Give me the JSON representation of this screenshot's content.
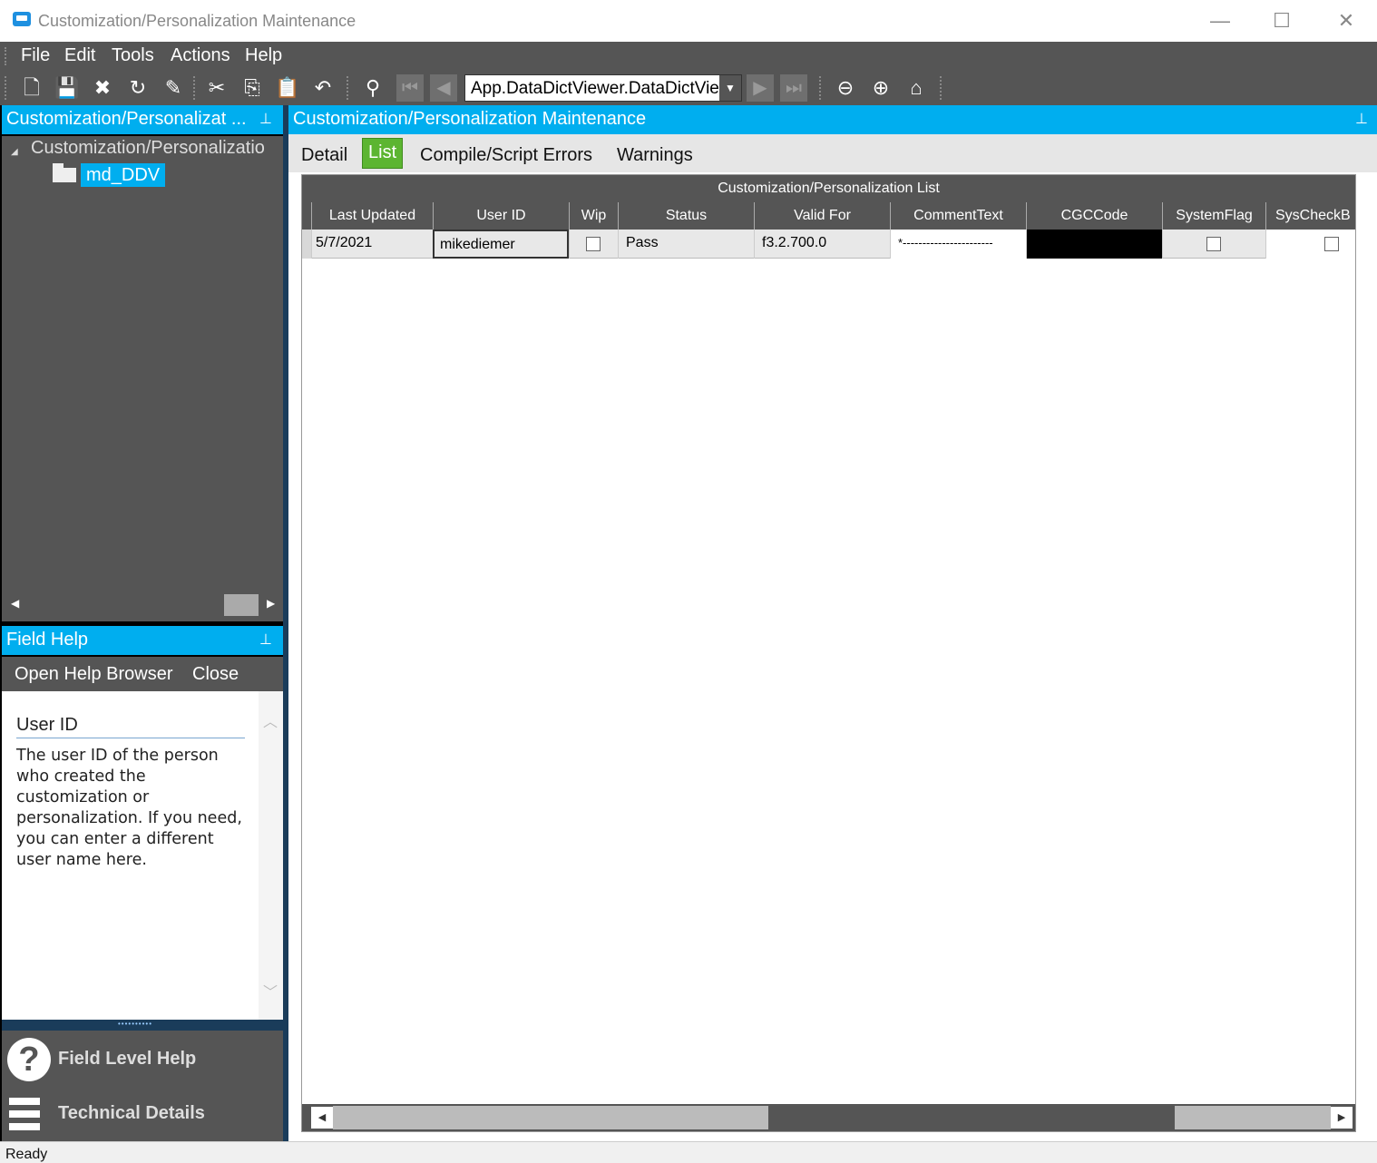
{
  "window": {
    "title": "Customization/Personalization Maintenance",
    "minimize_glyph": "—",
    "maximize_glyph": "☐",
    "close_glyph": "✕"
  },
  "menu": [
    "File",
    "Edit",
    "Tools",
    "Actions",
    "Help"
  ],
  "toolbar": {
    "combo_value": "App.DataDictViewer.DataDictViewer",
    "icons": [
      "new-icon",
      "save-icon",
      "delete-icon",
      "refresh-icon",
      "clear-icon",
      "cut-icon",
      "copy-icon",
      "paste-icon",
      "undo-icon",
      "search-icon",
      "first-record-icon",
      "previous-record-icon",
      "next-record-icon",
      "last-record-icon",
      "back-icon",
      "forward-icon",
      "home-icon"
    ]
  },
  "tree_panel": {
    "header": "Customization/Personalizat ...",
    "root_label": "Customization/Personalizatio",
    "child_label": "md_DDV"
  },
  "field_help": {
    "header": "Field Help",
    "open_browser": "Open Help Browser",
    "close": "Close",
    "title": "User ID",
    "text": "The user ID of the person who created the customization or personalization. If you need, you can enter a different user name here."
  },
  "nav": {
    "field_level_help": "Field Level Help",
    "technical_details": "Technical Details"
  },
  "main": {
    "header": "Customization/Personalization Maintenance",
    "tabs": [
      "Detail",
      "List",
      "Compile/Script Errors",
      "Warnings"
    ],
    "active_tab": "List",
    "grid": {
      "caption": "Customization/Personalization List",
      "columns": [
        "Last Updated",
        "User ID",
        "Wip",
        "Status",
        "Valid For",
        "CommentText",
        "CGCCode",
        "SystemFlag",
        "SysCheckB"
      ],
      "rows": [
        {
          "last_updated": "5/7/2021",
          "user_id": "mikediemer",
          "wip": false,
          "status": "Pass",
          "valid_for": "f3.2.700.0",
          "comment_text": "*-----------------------",
          "cgc_code": "",
          "system_flag": false,
          "sys_check": false
        }
      ]
    }
  },
  "status": {
    "text": "Ready"
  }
}
